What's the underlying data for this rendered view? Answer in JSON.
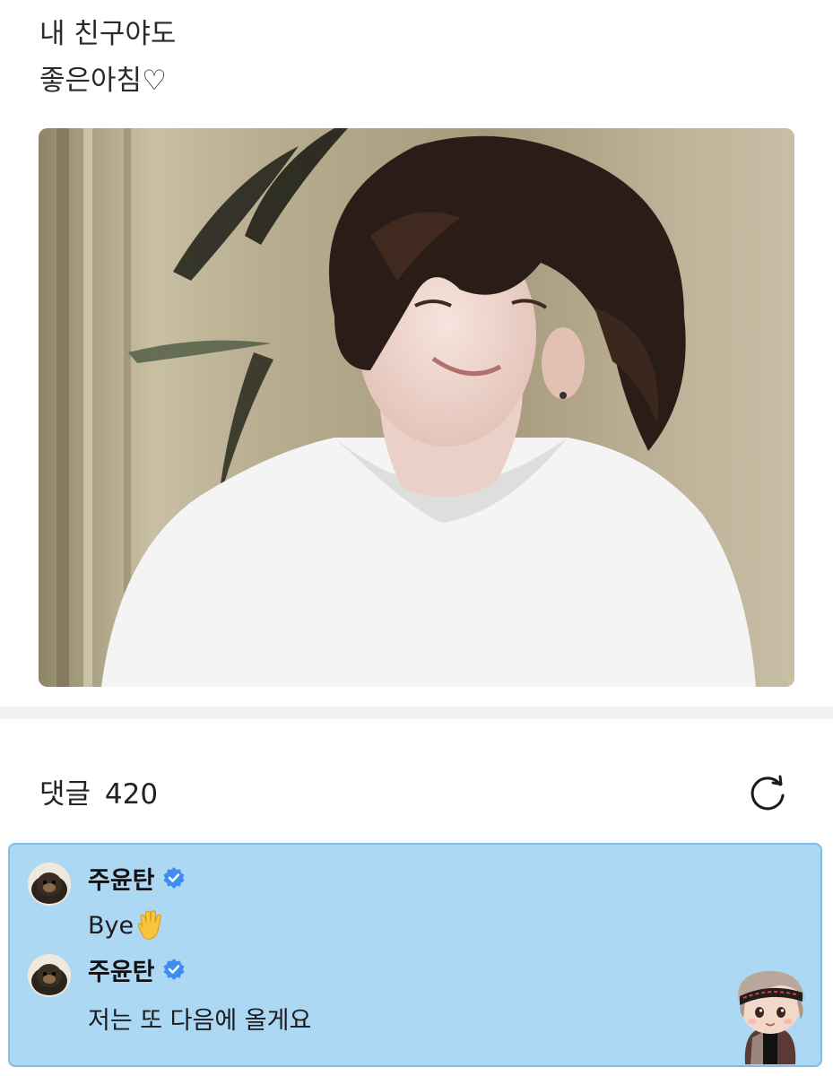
{
  "post": {
    "lines": [
      "내 친구야도",
      "좋은아침♡"
    ]
  },
  "photo": {
    "subject": "photo-of-person"
  },
  "comments_section": {
    "label": "댓글",
    "count": "420",
    "refresh_icon": "refresh-icon"
  },
  "comments": [
    {
      "author": "주윤탄",
      "verified": true,
      "text": "Bye",
      "emoji": "waving-hand-icon"
    },
    {
      "author": "주윤탄",
      "verified": true,
      "text": "저는 또 다음에 올게요"
    }
  ],
  "colors": {
    "highlight_bg": "#acd8f3",
    "highlight_border": "#7dbde8",
    "verified_badge": "#3d8ef0",
    "divider": "#f0f1f3"
  }
}
